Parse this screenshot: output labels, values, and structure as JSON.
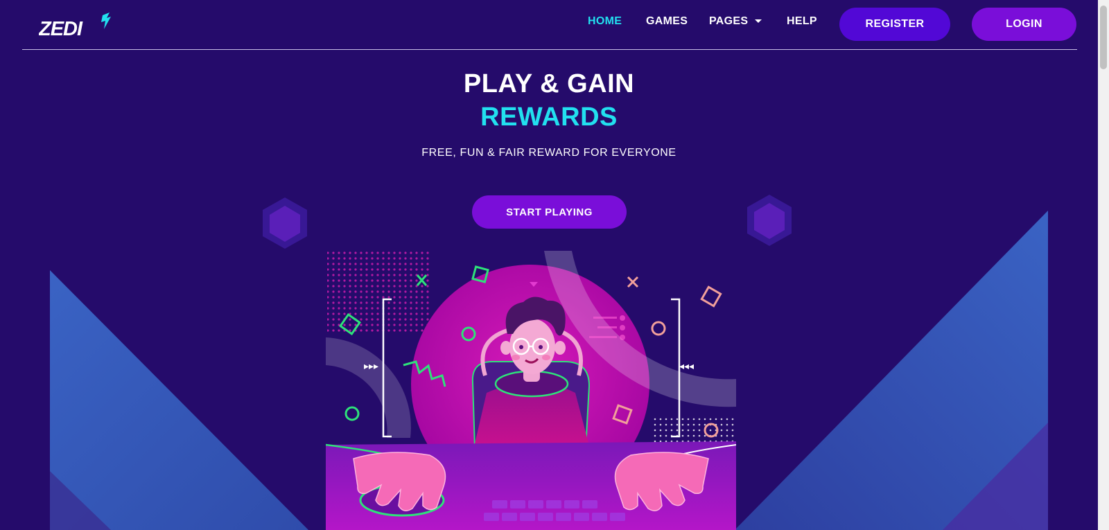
{
  "brand": {
    "logo_text": "ZEDI"
  },
  "nav": {
    "items": [
      {
        "label": "HOME",
        "active": true
      },
      {
        "label": "GAMES",
        "active": false
      },
      {
        "label": "PAGES",
        "active": false,
        "has_dropdown": true
      },
      {
        "label": "HELP",
        "active": false
      }
    ],
    "register_label": "REGISTER",
    "login_label": "LOGIN"
  },
  "hero": {
    "title_line1": "PLAY & GAIN",
    "title_line2": "REWARDS",
    "subtitle": "FREE, FUN & FAIR REWARD FOR EVERYONE",
    "cta_label": "START PLAYING"
  },
  "colors": {
    "background": "#250b6b",
    "accent_cyan": "#22e0ef",
    "button_register": "#5208d6",
    "button_purple": "#7a0ed9",
    "illustration_magenta": "#c010b0",
    "neon_green": "#2ee27a"
  },
  "icons": [
    "zedi-logo-icon",
    "chevron-down-icon",
    "gamer-illustration"
  ]
}
